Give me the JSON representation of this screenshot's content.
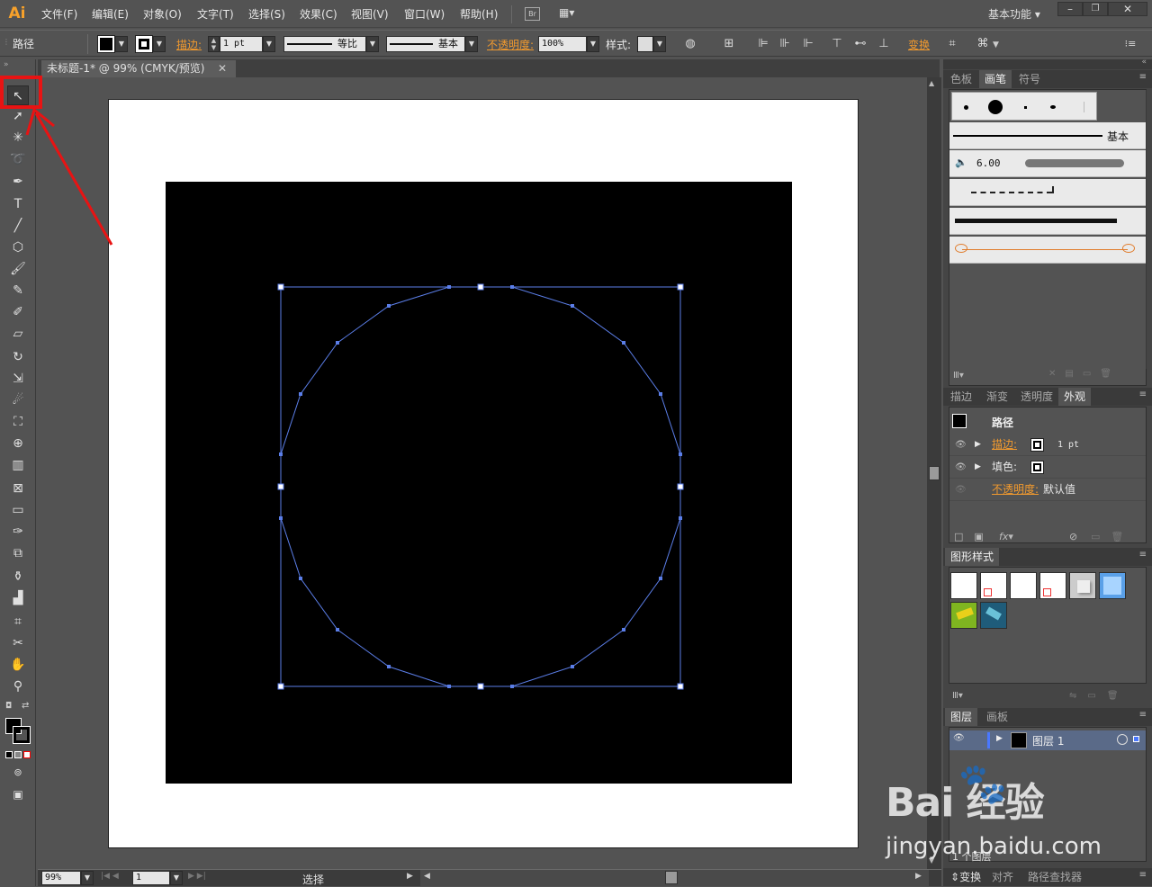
{
  "app": {
    "logo": "Ai",
    "workspace": "基本功能"
  },
  "menu": {
    "items": [
      "文件(F)",
      "编辑(E)",
      "对象(O)",
      "文字(T)",
      "选择(S)",
      "效果(C)",
      "视图(V)",
      "窗口(W)",
      "帮助(H)"
    ],
    "bridge": "Br"
  },
  "control": {
    "object_type": "路径",
    "stroke_label": "描边:",
    "stroke_weight": "1 pt",
    "profile": "等比",
    "brush": "基本",
    "opacity_label": "不透明度:",
    "opacity_value": "100%",
    "style_label": "样式:",
    "transform_label": "变换"
  },
  "document": {
    "tab_title": "未标题-1* @ 99% (CMYK/预览)"
  },
  "statusbar": {
    "zoom": "99%",
    "page": "1",
    "tool": "选择"
  },
  "panels": {
    "brushes": {
      "tabs": [
        "色板",
        "画笔",
        "符号"
      ],
      "active": "画笔",
      "basic_label": "基本",
      "calligraphic_size": "6.00"
    },
    "appearance": {
      "tabs": [
        "描边",
        "渐变",
        "透明度",
        "外观"
      ],
      "active": "外观",
      "title": "路径",
      "stroke_label": "描边:",
      "stroke_value": "1 pt",
      "fill_label": "填色:",
      "opacity_label": "不透明度:",
      "opacity_value": "默认值"
    },
    "graphic_styles": {
      "title": "图形样式"
    },
    "layers": {
      "tabs": [
        "图层",
        "画板"
      ],
      "active": "图层",
      "layer_name": "图层 1",
      "count": "1 个图层"
    },
    "bottom_tabs": [
      "变换",
      "对齐",
      "路径查找器"
    ]
  },
  "watermark": {
    "brand": "Bai 经验",
    "url": "jingyan.baidu.com"
  },
  "colors": {
    "accent": "#f29a2e",
    "selection": "#5b7ee8",
    "highlight": "#e81313"
  }
}
